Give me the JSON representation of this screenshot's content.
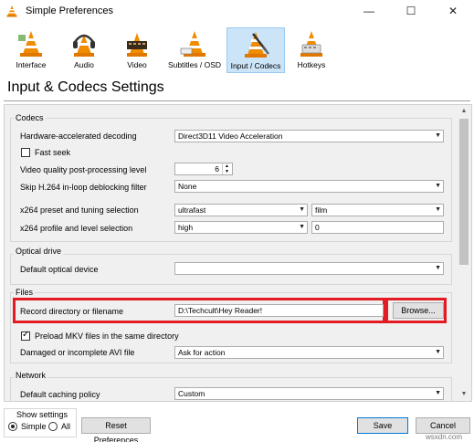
{
  "window": {
    "title": "Simple Preferences",
    "minimize": "—",
    "maximize": "☐",
    "close": "✕"
  },
  "toolbar": {
    "items": [
      {
        "label": "Interface",
        "icon": "vlc-cone-interface-icon"
      },
      {
        "label": "Audio",
        "icon": "headphones-cone-icon"
      },
      {
        "label": "Video",
        "icon": "film-cone-icon"
      },
      {
        "label": "Subtitles / OSD",
        "icon": "subtitles-cone-icon"
      },
      {
        "label": "Input / Codecs",
        "icon": "input-codecs-cone-icon",
        "selected": true
      },
      {
        "label": "Hotkeys",
        "icon": "hotkeys-cone-icon"
      }
    ]
  },
  "page_heading": "Input & Codecs Settings",
  "codecs": {
    "title": "Codecs",
    "hw_decoding_label": "Hardware-accelerated decoding",
    "hw_decoding_value": "Direct3D11 Video Acceleration",
    "fast_seek_label": "Fast seek",
    "fast_seek_checked": false,
    "pp_level_label": "Video quality post-processing level",
    "pp_level_value": "6",
    "skip_loop_label": "Skip H.264 in-loop deblocking filter",
    "skip_loop_value": "None",
    "x264_preset_label": "x264 preset and tuning selection",
    "x264_preset_value": "ultrafast",
    "x264_tune_value": "film",
    "x264_profile_label": "x264 profile and level selection",
    "x264_profile_value": "high",
    "x264_level_value": "0"
  },
  "optical": {
    "title": "Optical drive",
    "device_label": "Default optical device",
    "device_value": ""
  },
  "files": {
    "title": "Files",
    "record_label": "Record directory or filename",
    "record_value": "D:\\Techcult\\Hey Reader!",
    "browse_label": "Browse...",
    "preload_mkv_label": "Preload MKV files in the same directory",
    "preload_mkv_checked": true,
    "damaged_avi_label": "Damaged or incomplete AVI file",
    "damaged_avi_value": "Ask for action"
  },
  "network": {
    "title": "Network",
    "caching_label": "Default caching policy",
    "caching_value": "Custom"
  },
  "footer": {
    "show_settings_title": "Show settings",
    "simple_label": "Simple",
    "all_label": "All",
    "selected_mode": "Simple",
    "reset_label": "Reset Preferences",
    "save_label": "Save",
    "cancel_label": "Cancel"
  },
  "watermark": "wsxdn.com",
  "colors": {
    "highlight_border": "#e31b23",
    "selected_tab_bg": "#cce4f7",
    "cone_orange": "#f08c00"
  }
}
